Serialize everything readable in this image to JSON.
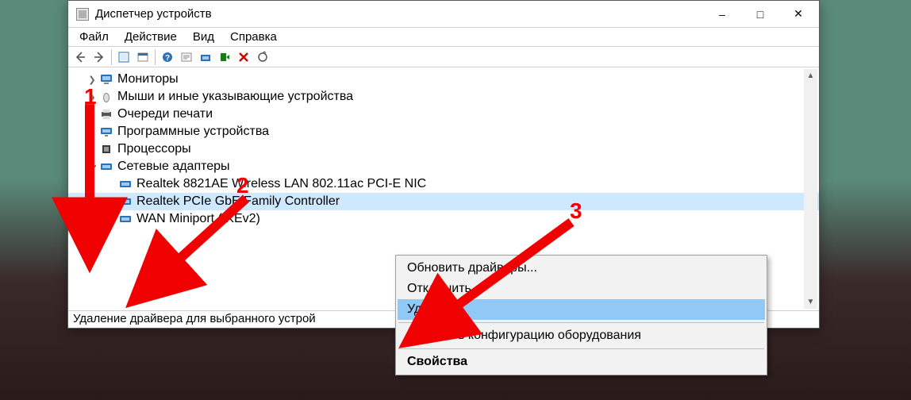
{
  "window": {
    "title": "Диспетчер устройств"
  },
  "menu": {
    "file": "Файл",
    "action": "Действие",
    "view": "Вид",
    "help": "Справка"
  },
  "tree": {
    "monitors": "Мониторы",
    "mice": "Мыши и иные указывающие устройства",
    "printq": "Очереди печати",
    "software": "Программные устройства",
    "cpus": "Процессоры",
    "netadapt": "Сетевые адаптеры",
    "wlan": "Realtek 8821AE Wireless LAN 802.11ac PCI-E NIC",
    "gbe": "Realtek PCIe GbE Family Controller",
    "wan": "WAN Miniport (IKEv2)"
  },
  "status": {
    "text": "Удаление драйвера для выбранного устрой"
  },
  "ctx": {
    "update": "Обновить драйверы...",
    "disable": "Отключить",
    "delete": "Удалить",
    "scan": "Обновить конфигурацию оборудования",
    "prop": "Свойства"
  },
  "anno": {
    "n1": "1",
    "n2": "2",
    "n3": "3"
  },
  "colors": {
    "arrow": "#f00000",
    "selection": "#cde8ff",
    "ctx_highlight": "#90c8f6"
  }
}
